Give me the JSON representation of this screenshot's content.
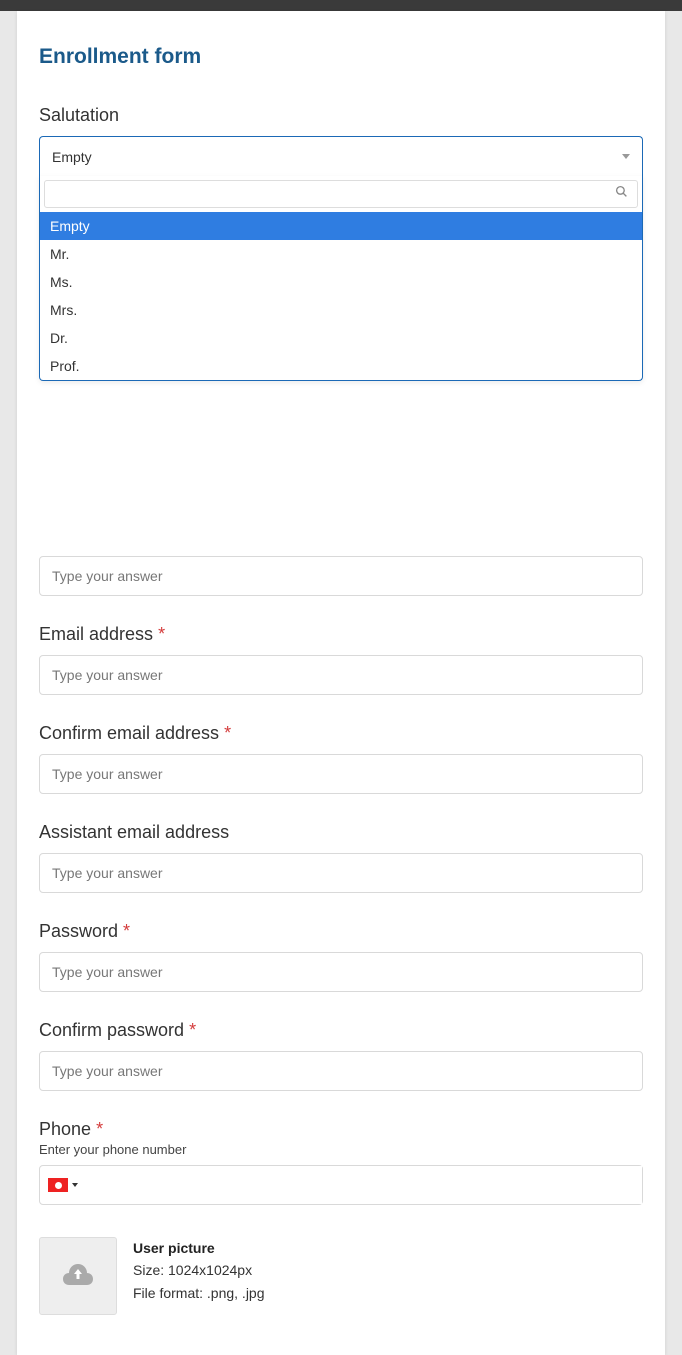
{
  "form": {
    "title": "Enrollment form",
    "placeholder": "Type your answer",
    "salutation": {
      "label": "Salutation",
      "selected": "Empty",
      "options": [
        "Empty",
        "Mr.",
        "Ms.",
        "Mrs.",
        "Dr.",
        "Prof."
      ]
    },
    "email": {
      "label": "Email address"
    },
    "confirm_email": {
      "label": "Confirm email address"
    },
    "assistant_email": {
      "label": "Assistant email address"
    },
    "password": {
      "label": "Password"
    },
    "confirm_password": {
      "label": "Confirm password"
    },
    "phone": {
      "label": "Phone",
      "hint": "Enter your phone number"
    },
    "user_picture": {
      "title": "User picture",
      "size": "Size: 1024x1024px",
      "format": "File format: .png, .jpg"
    },
    "required_mark": "*"
  }
}
